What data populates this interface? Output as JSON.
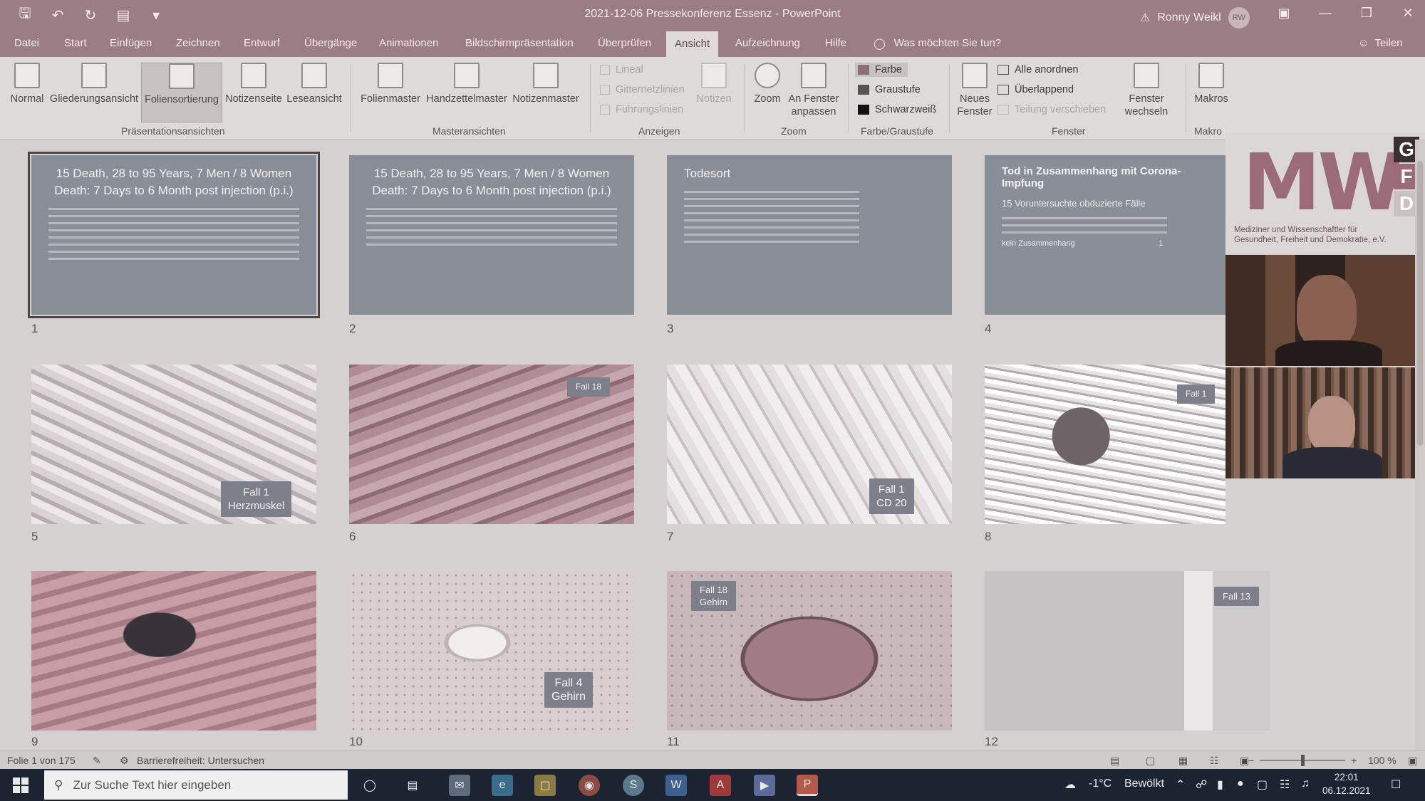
{
  "window": {
    "doc_title": "2021-12-06 Pressekonferenz Essenz - PowerPoint",
    "user_name": "Ronny Weikl",
    "user_initials": "RW"
  },
  "tabs": [
    "Datei",
    "Start",
    "Einfügen",
    "Zeichnen",
    "Entwurf",
    "Übergänge",
    "Animationen",
    "Bildschirmpräsentation",
    "Überprüfen",
    "Ansicht",
    "Aufzeichnung",
    "Hilfe"
  ],
  "active_tab": "Ansicht",
  "tell_me": "Was möchten Sie tun?",
  "share": "Teilen",
  "ribbon": {
    "presentation_views": {
      "label": "Präsentationsansichten",
      "items": [
        "Normal",
        "Gliederungsansicht",
        "Foliensortierung",
        "Notizenseite",
        "Leseansicht"
      ]
    },
    "master_views": {
      "label": "Masteransichten",
      "items": [
        "Folienmaster",
        "Handzettelmaster",
        "Notizenmaster"
      ]
    },
    "show": {
      "label": "Anzeigen",
      "checks": [
        "Lineal",
        "Gitternetzlinien",
        "Führungslinien"
      ],
      "notes": "Notizen"
    },
    "zoom": {
      "label": "Zoom",
      "zoom": "Zoom",
      "fit_line1": "An Fenster",
      "fit_line2": "anpassen"
    },
    "color": {
      "label": "Farbe/Graustufe",
      "items": [
        "Farbe",
        "Graustufe",
        "Schwarzweiß"
      ]
    },
    "window_group": {
      "label": "Fenster",
      "new_line1": "Neues",
      "new_line2": "Fenster",
      "items": [
        "Alle anordnen",
        "Überlappend",
        "Teilung verschieben"
      ],
      "switch_line1": "Fenster",
      "switch_line2": "wechseln"
    },
    "macros": {
      "label": "Makro",
      "button": "Makros"
    }
  },
  "slides": [
    {
      "num": "1",
      "title1": "15 Death, 28 to 95 Years, 7 Men / 8 Women",
      "title2": "Death: 7 Days to 6 Month  post injection (p.i.)"
    },
    {
      "num": "2",
      "title1": "15 Death, 28 to 95 Years, 7 Men / 8 Women",
      "title2": "Death: 7 Days to 6 Month  post injection (p.i.)"
    },
    {
      "num": "3",
      "title1": "Todesort"
    },
    {
      "num": "4",
      "title1": "Tod in Zusammenhang mit Corona-Impfung",
      "title2": "15 Voruntersuchte obduzierte Fälle",
      "item": "kein Zusammenhang",
      "value": "1"
    },
    {
      "num": "5",
      "label1": "Fall 1",
      "label2": "Herzmuskel"
    },
    {
      "num": "6",
      "label1": "Fall 18"
    },
    {
      "num": "7",
      "label1": "Fall 1",
      "label2": "CD 20"
    },
    {
      "num": "8",
      "label1": "Fall 1"
    },
    {
      "num": "9"
    },
    {
      "num": "10",
      "label1": "Fall 4",
      "label2": "Gehirn"
    },
    {
      "num": "11",
      "label1": "Fall 18",
      "label2": "Gehirn"
    },
    {
      "num": "12",
      "label1": "Fall 13"
    }
  ],
  "overlay": {
    "logo_letters": "MW",
    "logo_side": [
      "G",
      "F",
      "D"
    ],
    "caption1": "Mediziner und Wissenschaftler für",
    "caption2": "Gesundheit, Freiheit und Demokratie, e.V."
  },
  "status": {
    "slide_info": "Folie 1 von 175",
    "accessibility": "Barrierefreiheit: Untersuchen",
    "zoom": "100 %"
  },
  "taskbar": {
    "search_placeholder": "Zur Suche Text hier eingeben",
    "temperature": "-1°C",
    "weather": "Bewölkt",
    "time": "22:01",
    "date": "06.12.2021"
  },
  "colors": {
    "title_bar": "#9a7e84",
    "ribbon": "#dedad9",
    "slide_text_bg": "#8a8e97",
    "taskbar": "#1d2431"
  }
}
